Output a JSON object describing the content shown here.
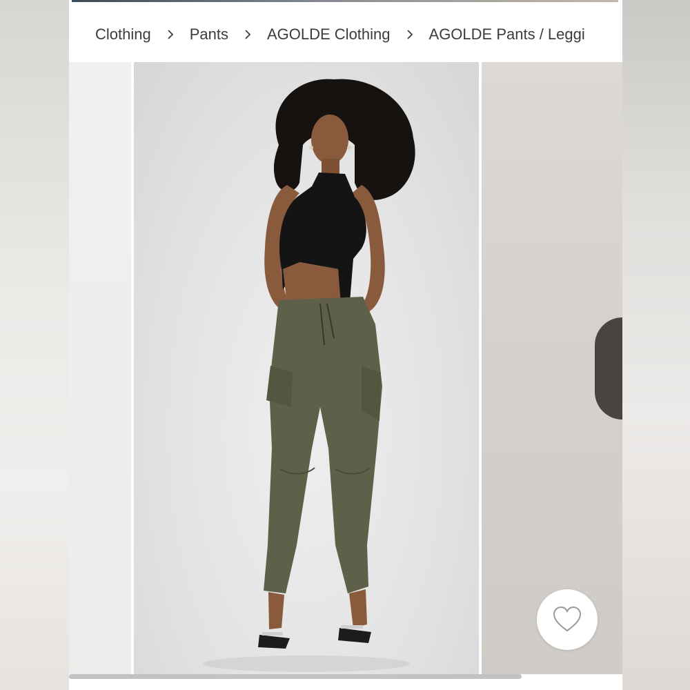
{
  "breadcrumb": {
    "items": [
      {
        "label": "Clothing"
      },
      {
        "label": "Pants"
      },
      {
        "label": "AGOLDE Clothing"
      },
      {
        "label": "AGOLDE Pants / Leggi"
      }
    ]
  },
  "gallery": {
    "main_image_alt_icon": "product-photo",
    "favorite_icon": "heart-outline-icon",
    "next_icon": "next-slide-tab"
  },
  "colors": {
    "text": "#3b3b3b",
    "pants": "#5f6049",
    "top": "#141414",
    "skin": "#8a5a3c",
    "hair": "#151210",
    "background": "#e3e3e3"
  }
}
